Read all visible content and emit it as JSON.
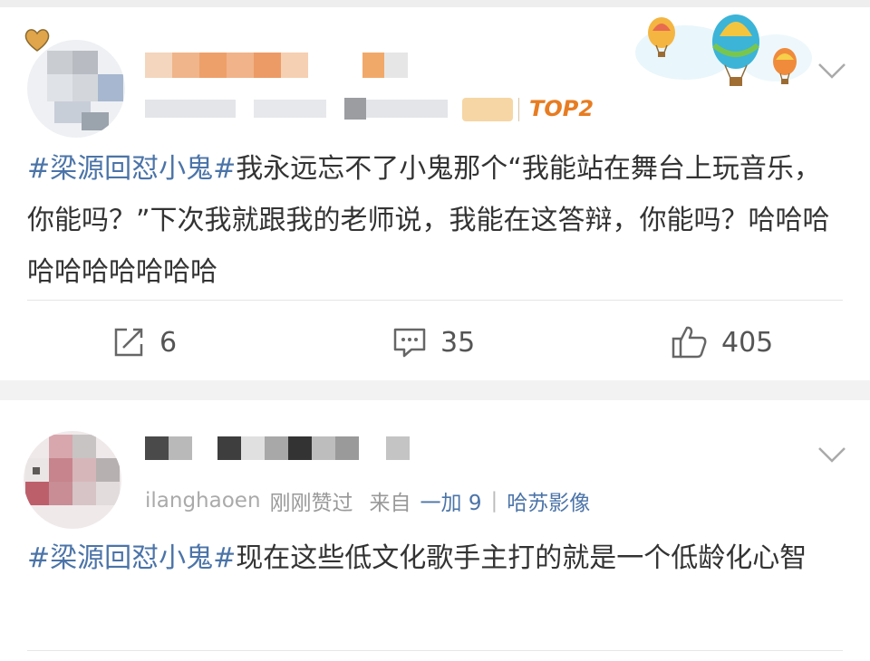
{
  "post1": {
    "badge": "TOP2",
    "topic": "#梁源回怼小鬼#",
    "text": "我永远忘不了小鬼那个“我能站在舞台上玩音乐，你能吗？”下次我就跟我的老师说，我能在这答辩，你能吗？哈哈哈哈哈哈哈哈哈哈",
    "actions": {
      "repost_count": "6",
      "comment_count": "35",
      "like_count": "405"
    },
    "icons": {
      "balloon_banner": "hot-air-balloons-icon",
      "heart": "heart-icon",
      "more": "chevron-down-icon",
      "repost": "repost-icon",
      "comment": "comment-icon",
      "like": "thumbs-up-icon"
    }
  },
  "post2": {
    "username_partial": "ilanghaoen",
    "liked_text": "刚刚赞过",
    "source_prefix": "来自",
    "device": "一加 9",
    "separator": "|",
    "source_tag": "哈苏影像",
    "topic": "#梁源回怼小鬼#",
    "text": "现在这些低文化歌手主打的就是一个低龄化心智",
    "icons": {
      "more": "chevron-down-icon"
    }
  },
  "colors": {
    "topic_link": "#4b74a8",
    "badge": "#e77c22",
    "meta": "#999999"
  }
}
